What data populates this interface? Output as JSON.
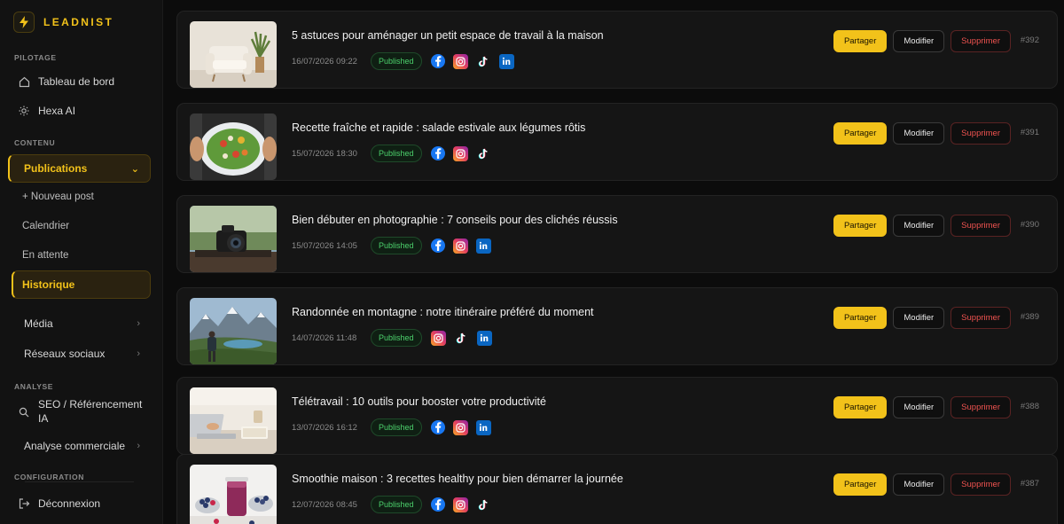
{
  "brand": {
    "name": "LEADNIST"
  },
  "sidebar": {
    "sections": {
      "pilotage": "PILOTAGE",
      "contenu": "CONTENU",
      "analyse": "ANALYSE",
      "configuration": "CONFIGURATION"
    },
    "items": {
      "dashboard": "Tableau de bord",
      "hexa": "Hexa AI",
      "publications": "Publications",
      "new_post": "+ Nouveau post",
      "calendar": "Calendrier",
      "pending": "En attente",
      "history": "Historique",
      "media": "Média",
      "social": "Réseaux sociaux",
      "seo": "SEO / Référencement",
      "seo2": "IA",
      "commercial": "Analyse commerciale",
      "logout": "Déconnexion"
    }
  },
  "actions": {
    "share": "Partager",
    "edit": "Modifier",
    "delete": "Supprimer"
  },
  "colors": {
    "accent": "#f2c21a",
    "published": "#4cd16c",
    "danger": "#ef5350"
  },
  "posts": [
    {
      "title": "5 astuces pour aménager un petit espace de travail à la maison",
      "date": "16/07/2026 09:22",
      "status": "Published",
      "id": "#392",
      "networks": [
        "facebook",
        "instagram",
        "tiktok",
        "linkedin"
      ],
      "thumb": "armchair"
    },
    {
      "title": "Recette fraîche et rapide : salade estivale aux légumes rôtis",
      "date": "15/07/2026 18:30",
      "status": "Published",
      "id": "#391",
      "networks": [
        "facebook",
        "instagram",
        "tiktok"
      ],
      "thumb": "salad"
    },
    {
      "title": "Bien débuter en photographie : 7 conseils pour des clichés réussis",
      "date": "15/07/2026 14:05",
      "status": "Published",
      "id": "#390",
      "networks": [
        "facebook",
        "instagram",
        "linkedin"
      ],
      "thumb": "camera"
    },
    {
      "title": "Randonnée en montagne : notre itinéraire préféré du moment",
      "date": "14/07/2026 11:48",
      "status": "Published",
      "id": "#389",
      "networks": [
        "instagram",
        "tiktok",
        "linkedin"
      ],
      "thumb": "mountain"
    },
    {
      "title": "Télétravail : 10 outils pour booster votre productivité",
      "date": "13/07/2026 16:12",
      "status": "Published",
      "id": "#388",
      "networks": [
        "facebook",
        "instagram",
        "linkedin"
      ],
      "thumb": "laptop"
    },
    {
      "title": "Smoothie maison : 3 recettes healthy pour bien démarrer la journée",
      "date": "12/07/2026 08:45",
      "status": "Published",
      "id": "#387",
      "networks": [
        "facebook",
        "instagram",
        "tiktok"
      ],
      "thumb": "smoothie"
    }
  ]
}
